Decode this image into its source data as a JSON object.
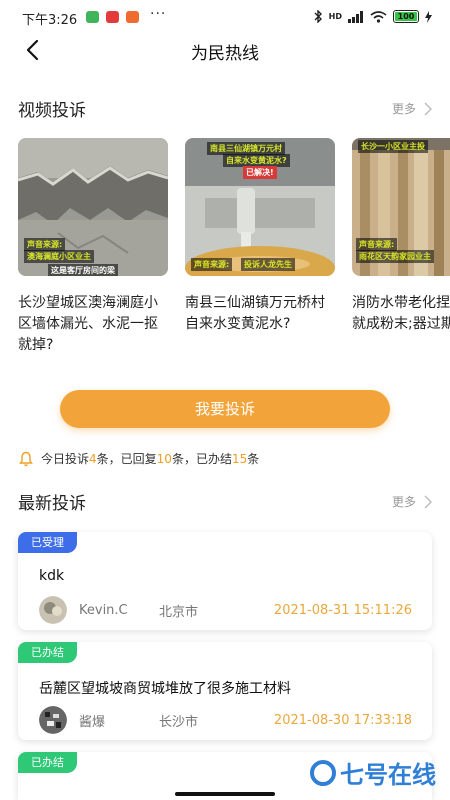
{
  "status_bar": {
    "time": "下午3:26",
    "dots": "···",
    "network": "HD",
    "battery": "100"
  },
  "nav": {
    "title": "为民热线"
  },
  "video_section": {
    "title": "视频投诉",
    "more": "更多",
    "items": [
      {
        "caption_1": "声音来源:",
        "caption_2": "澳海澜庭小区业主",
        "caption_3": "这是客厅房间的梁",
        "title": "长沙望城区澳海澜庭小区墙体漏光、水泥一抠就掉?"
      },
      {
        "caption_top_1": "南县三仙湖镇万元村",
        "caption_top_2": "自来水变黄泥水?",
        "caption_top_3": "已解决!",
        "caption_1": "声音来源:",
        "caption_2": "投诉人龙先生",
        "title": "南县三仙湖镇万元桥村自来水变黄泥水?"
      },
      {
        "caption_top": "长沙一小区业主投",
        "caption_1": "声音来源:",
        "caption_2": "雨花区天韵家园业主",
        "title": "消防水带老化捏就成粉末;器过期!"
      }
    ]
  },
  "complain_button": "我要投诉",
  "stats": {
    "prefix": "今日投诉",
    "complaints": "4",
    "sep1": "条，已回复",
    "replies": "10",
    "sep2": "条，已办结",
    "done": "15",
    "suffix": "条"
  },
  "latest_section": {
    "title": "最新投诉",
    "more": "更多",
    "posts": [
      {
        "status": "已受理",
        "status_color": "#3d6de8",
        "title": "kdk",
        "user": "Kevin.C",
        "city": "北京市",
        "time": "2021-08-31 15:11:26"
      },
      {
        "status": "已办结",
        "status_color": "#2fc876",
        "title": "岳麓区望城坡商贸城堆放了很多施工材料",
        "user": "酱爆",
        "city": "长沙市",
        "time": "2021-08-30 17:33:18"
      },
      {
        "status": "已办结",
        "status_color": "#2fc876"
      }
    ]
  },
  "watermark": "七号在线",
  "colors": {
    "accent_orange": "#f2a43a",
    "accepted_blue": "#3d6de8",
    "done_green": "#2fc876"
  }
}
